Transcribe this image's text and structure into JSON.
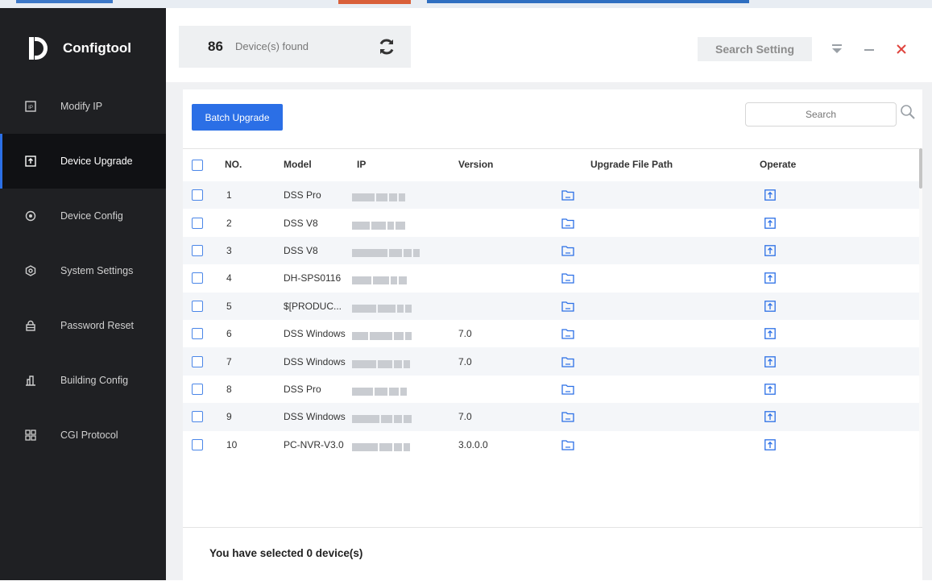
{
  "app": {
    "title": "Configtool"
  },
  "sidebar": {
    "items": [
      {
        "label": "Modify IP",
        "icon": "ip-icon",
        "active": false
      },
      {
        "label": "Device Upgrade",
        "icon": "upgrade-icon",
        "active": true
      },
      {
        "label": "Device Config",
        "icon": "device-config-icon",
        "active": false
      },
      {
        "label": "System Settings",
        "icon": "settings-icon",
        "active": false
      },
      {
        "label": "Password Reset",
        "icon": "lock-icon",
        "active": false
      },
      {
        "label": "Building Config",
        "icon": "building-icon",
        "active": false
      },
      {
        "label": "CGI Protocol",
        "icon": "cgi-icon",
        "active": false
      }
    ]
  },
  "header": {
    "device_count": "86",
    "device_label": "Device(s) found",
    "search_setting_label": "Search Setting"
  },
  "toolbar": {
    "batch_upgrade_label": "Batch Upgrade",
    "search_placeholder": "Search"
  },
  "table": {
    "columns": {
      "no": "NO.",
      "model": "Model",
      "ip": "IP",
      "version": "Version",
      "path": "Upgrade File Path",
      "operate": "Operate"
    },
    "rows": [
      {
        "no": "1",
        "model": "DSS Pro",
        "version": ""
      },
      {
        "no": "2",
        "model": "DSS V8",
        "version": ""
      },
      {
        "no": "3",
        "model": "DSS V8",
        "version": ""
      },
      {
        "no": "4",
        "model": "DH-SPS0116",
        "version": ""
      },
      {
        "no": "5",
        "model": "$[PRODUC...",
        "version": ""
      },
      {
        "no": "6",
        "model": "DSS Windows",
        "version": "7.0"
      },
      {
        "no": "7",
        "model": "DSS Windows",
        "version": "7.0"
      },
      {
        "no": "8",
        "model": "DSS Pro",
        "version": ""
      },
      {
        "no": "9",
        "model": "DSS Windows",
        "version": "7.0"
      },
      {
        "no": "10",
        "model": "PC-NVR-V3.0",
        "version": "3.0.0.0"
      }
    ]
  },
  "footer": {
    "selection_text": "You have selected 0  device(s)"
  },
  "colors": {
    "accent": "#2b6fe6",
    "sidebar_bg": "#1f2023",
    "close": "#e0443e"
  }
}
